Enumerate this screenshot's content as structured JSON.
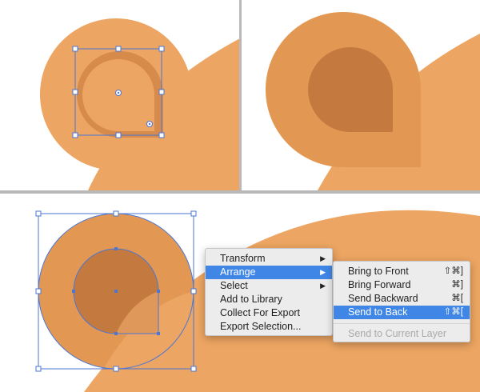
{
  "colors": {
    "light_orange": "#eca562",
    "medium_orange": "#e29853",
    "dark_orange": "#c47a3e",
    "selection_blue": "#4a77d6",
    "menu_highlight": "#3f86e6"
  },
  "context_menu": {
    "items": [
      {
        "label": "Transform",
        "has_submenu": true
      },
      {
        "label": "Arrange",
        "has_submenu": true,
        "selected": true
      },
      {
        "label": "Select",
        "has_submenu": true
      },
      {
        "label": "Add to Library"
      },
      {
        "label": "Collect For Export"
      },
      {
        "label": "Export Selection..."
      }
    ]
  },
  "arrange_submenu": {
    "items": [
      {
        "label": "Bring to Front",
        "shortcut": "⇧⌘]"
      },
      {
        "label": "Bring Forward",
        "shortcut": "⌘]"
      },
      {
        "label": "Send Backward",
        "shortcut": "⌘["
      },
      {
        "label": "Send to Back",
        "shortcut": "⇧⌘[",
        "selected": true
      },
      {
        "label": "Send to Current Layer",
        "disabled": true
      }
    ]
  },
  "icons": {
    "submenu_arrow": "right-triangle-icon"
  }
}
